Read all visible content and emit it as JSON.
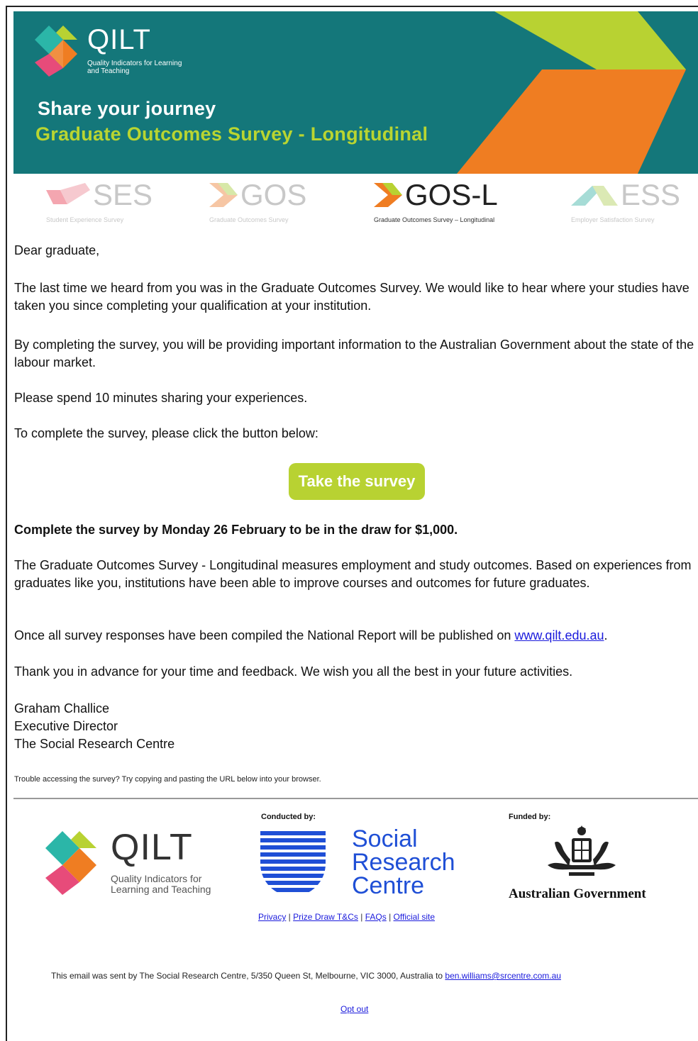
{
  "header": {
    "brand": "QILT",
    "brand_tagline": "Quality Indicators for Learning and Teaching",
    "title": "Share your journey",
    "subtitle": "Graduate Outcomes Survey - Longitudinal"
  },
  "survey_logos": [
    {
      "abbr": "SES",
      "full": "Student Experience Survey",
      "color": "#f4a6b0"
    },
    {
      "abbr": "GOS",
      "full": "Graduate Outcomes Survey",
      "color": "#f6b48a"
    },
    {
      "abbr": "GOS-L",
      "full": "Graduate Outcomes Survey – Longitudinal",
      "color": "#ef7d22"
    },
    {
      "abbr": "ESS",
      "full": "Employer Satisfaction Survey",
      "color": "#a6dcd6"
    }
  ],
  "body": {
    "greeting": "Dear graduate,",
    "p1": "The last time we heard from you was in the Graduate Outcomes Survey. We would like to hear where your studies have taken you since completing your qualification at your institution.",
    "p2": "By completing the survey, you will be providing important information to the Australian Government about the state of the labour market.",
    "p3": "Please spend 10 minutes sharing your experiences.",
    "p4": "To complete the survey, please click the button below:",
    "cta_label": "Take the survey",
    "deadline": "Complete the survey by Monday 26 February to be in the draw for $1,000.",
    "p5": "The Graduate Outcomes Survey - Longitudinal measures employment and study outcomes. Based on experiences from graduates like you, institutions have been able to improve courses and outcomes for future graduates.",
    "p6_before": "Once all survey responses have been compiled the National Report will be published on ",
    "p6_link": "www.qilt.edu.au",
    "p6_after": ".",
    "p7": "Thank you in advance for your time and feedback. We wish you all the best in your future activities.",
    "sig_name": "Graham Challice",
    "sig_title": "Executive Director",
    "sig_org": "The Social Research Centre",
    "trouble": "Trouble accessing the survey? Try copying and pasting the URL below into your browser."
  },
  "footer": {
    "qilt_brand": "QILT",
    "qilt_tagline": "Quality Indicators for Learning and Teaching",
    "conducted_by": "Conducted by:",
    "src_line1": "Social",
    "src_line2": "Research",
    "src_line3": "Centre",
    "funded_by": "Funded by:",
    "ausgov": "Australian Government",
    "links": [
      "Privacy",
      "Prize Draw T&Cs",
      "FAQs",
      "Official site"
    ],
    "sent_by_text": "This email was sent by The Social Research Centre, 5/350 Queen St, Melbourne, VIC 3000, Australia to ",
    "sent_by_email": "ben.williams@srcentre.com.au",
    "opt_out": "Opt out"
  },
  "colors": {
    "banner_teal": "#14777a",
    "accent_green": "#b8d232",
    "accent_orange": "#ef7d22",
    "link_blue": "#1a1adc",
    "src_blue": "#1f4fd6"
  }
}
